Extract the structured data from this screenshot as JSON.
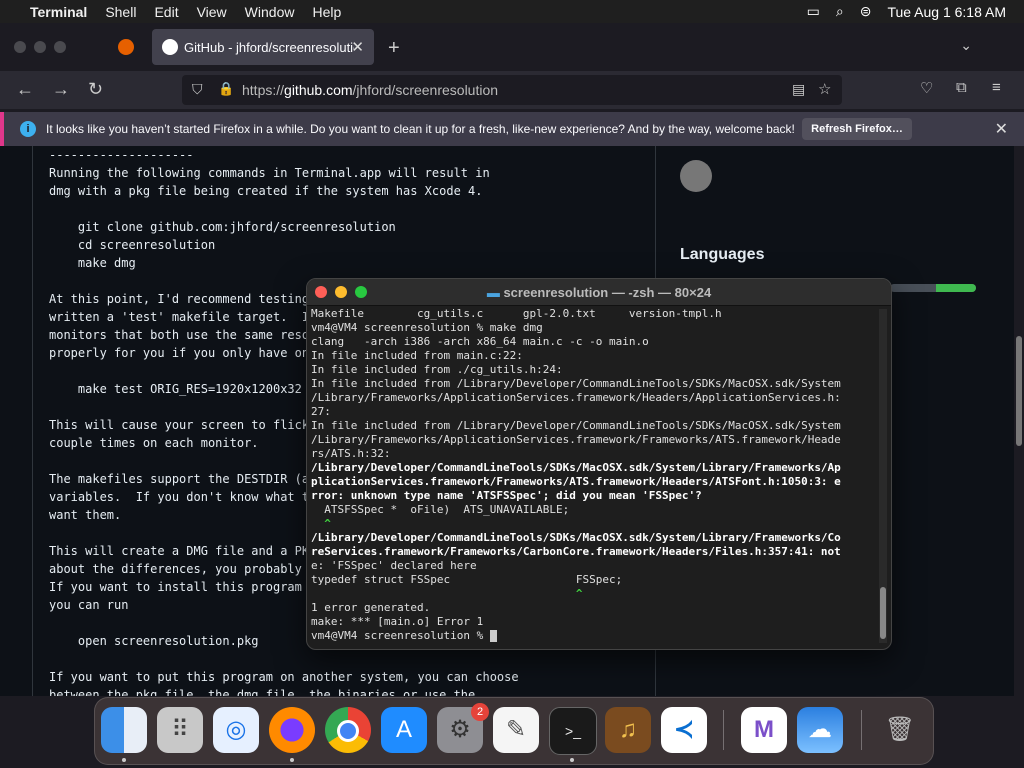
{
  "menubar": {
    "app": "Terminal",
    "items": [
      "Shell",
      "Edit",
      "View",
      "Window",
      "Help"
    ],
    "clock": "Tue Aug 1  6:18 AM"
  },
  "browser": {
    "tab_title": "GitHub - jhford/screenresolution",
    "url_prefix": "https://",
    "url_host": "github.com",
    "url_path": "/jhford/screenresolution",
    "notice": "It looks like you haven’t started Firefox in a while. Do you want to clean it up for a fresh, like-new experience? And by the way, welcome back!",
    "notice_button": "Refresh Firefox…"
  },
  "readme": {
    "text": "--------------------\nRunning the following commands in Terminal.app will result in\ndmg with a pkg file being created if the system has Xcode 4.\n\n    git clone github.com:jhford/screenresolution\n    cd screenresolution\n    make dmg\n\nAt this point, I'd recommend testing\nwritten a 'test' makefile target.  I\nmonitors that both use the same reso\nproperly for you if you only have on\n\n    make test ORIG_RES=1920x1200x32\n\nThis will cause your screen to flick\ncouple times on each monitor.\n\nThe makefiles support the DESTDIR (a\nvariables.  If you don't know what t\nwant them.\n\nThis will create a DMG file and a PK\nabout the differences, you probably\nIf you want to install this program\nyou can run\n\n    open screenresolution.pkg\n\nIf you want to put this program on another system, you can choose\nbetween the pkg file, the dmg file, the binaries or use the"
  },
  "sidebar": {
    "languages_heading": "Languages"
  },
  "terminal": {
    "title": "screenresolution — -zsh — 80×24",
    "lines": [
      {
        "t": "Makefile        cg_utils.c      gpl-2.0.txt     version-tmpl.h",
        "c": ""
      },
      {
        "t": "vm4@VM4 screenresolution % make dmg",
        "c": ""
      },
      {
        "t": "clang   -arch i386 -arch x86_64 main.c -c -o main.o",
        "c": ""
      },
      {
        "t": "In file included from main.c:22:",
        "c": ""
      },
      {
        "t": "In file included from ./cg_utils.h:24:",
        "c": ""
      },
      {
        "t": "In file included from /Library/Developer/CommandLineTools/SDKs/MacOSX.sdk/System",
        "c": ""
      },
      {
        "t": "/Library/Frameworks/ApplicationServices.framework/Headers/ApplicationServices.h:",
        "c": ""
      },
      {
        "t": "27:",
        "c": ""
      },
      {
        "t": "In file included from /Library/Developer/CommandLineTools/SDKs/MacOSX.sdk/System",
        "c": ""
      },
      {
        "t": "/Library/Frameworks/ApplicationServices.framework/Frameworks/ATS.framework/Heade",
        "c": ""
      },
      {
        "t": "rs/ATS.h:32:",
        "c": ""
      },
      {
        "t": "/Library/Developer/CommandLineTools/SDKs/MacOSX.sdk/System/Library/Frameworks/Ap",
        "c": "bold"
      },
      {
        "t": "plicationServices.framework/Frameworks/ATS.framework/Headers/ATSFont.h:1050:3: e",
        "c": "bold"
      },
      {
        "t": "rror: unknown type name 'ATSFSSpec'; did you mean 'FSSpec'?",
        "c": "bold"
      },
      {
        "t": "  ATSFSSpec *  oFile)  ATS_UNAVAILABLE;",
        "c": ""
      },
      {
        "t": "  ^",
        "c": "grn"
      },
      {
        "t": "/Library/Developer/CommandLineTools/SDKs/MacOSX.sdk/System/Library/Frameworks/Co",
        "c": "bold"
      },
      {
        "t": "reServices.framework/Frameworks/CarbonCore.framework/Headers/Files.h:357:41: not",
        "c": "bold"
      },
      {
        "t": "e: 'FSSpec' declared here",
        "c": ""
      },
      {
        "t": "typedef struct FSSpec                   FSSpec;",
        "c": ""
      },
      {
        "t": "                                        ^",
        "c": "grn"
      },
      {
        "t": "1 error generated.",
        "c": ""
      },
      {
        "t": "make: *** [main.o] Error 1",
        "c": ""
      },
      {
        "t": "vm4@VM4 screenresolution % ",
        "c": ""
      }
    ]
  },
  "dock": {
    "settings_badge": "2",
    "apps": [
      "finder-icon",
      "launchpad-icon",
      "safari-icon",
      "firefox-icon",
      "chrome-icon",
      "app-store-icon",
      "system-settings-icon",
      "textedit-icon",
      "terminal-icon",
      "instruments-icon",
      "vscode-icon",
      "visual-studio-icon",
      "weather-icon",
      "trash-icon"
    ]
  }
}
